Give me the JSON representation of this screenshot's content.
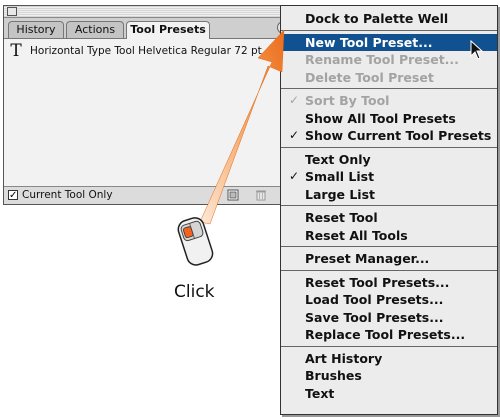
{
  "palette": {
    "tabs": [
      "History",
      "Actions",
      "Tool Presets"
    ],
    "active_tab": "Tool Presets",
    "list_items": [
      {
        "icon": "type-tool-icon",
        "glyph": "T",
        "label": "Horizontal Type Tool Helvetica Regular 72 pt"
      }
    ],
    "current_tool_only": {
      "checked": true,
      "label": "Current Tool Only"
    }
  },
  "menu": {
    "groups": [
      [
        {
          "label": "Dock to Palette Well",
          "enabled": true,
          "checked": false
        }
      ],
      [
        {
          "label": "New Tool Preset...",
          "enabled": true,
          "checked": false,
          "selected": true
        },
        {
          "label": "Rename Tool Preset...",
          "enabled": false,
          "checked": false
        },
        {
          "label": "Delete Tool Preset",
          "enabled": false,
          "checked": false
        }
      ],
      [
        {
          "label": "Sort By Tool",
          "enabled": false,
          "checked": true
        },
        {
          "label": "Show All Tool Presets",
          "enabled": true,
          "checked": false
        },
        {
          "label": "Show Current Tool Presets",
          "enabled": true,
          "checked": true
        }
      ],
      [
        {
          "label": "Text Only",
          "enabled": true,
          "checked": false
        },
        {
          "label": "Small List",
          "enabled": true,
          "checked": true
        },
        {
          "label": "Large List",
          "enabled": true,
          "checked": false
        }
      ],
      [
        {
          "label": "Reset Tool",
          "enabled": true,
          "checked": false
        },
        {
          "label": "Reset All Tools",
          "enabled": true,
          "checked": false
        }
      ],
      [
        {
          "label": "Preset Manager...",
          "enabled": true,
          "checked": false
        }
      ],
      [
        {
          "label": "Reset Tool Presets...",
          "enabled": true,
          "checked": false
        },
        {
          "label": "Load Tool Presets...",
          "enabled": true,
          "checked": false
        },
        {
          "label": "Save Tool Presets...",
          "enabled": true,
          "checked": false
        },
        {
          "label": "Replace Tool Presets...",
          "enabled": true,
          "checked": false
        }
      ],
      [
        {
          "label": "Art History",
          "enabled": true,
          "checked": false
        },
        {
          "label": "Brushes",
          "enabled": true,
          "checked": false
        },
        {
          "label": "Text",
          "enabled": true,
          "checked": false
        }
      ]
    ]
  },
  "callout": {
    "label": "Click"
  },
  "colors": {
    "selection": "#11518f",
    "arrow": "#f07a2a",
    "disabled": "#a3a3a3"
  }
}
